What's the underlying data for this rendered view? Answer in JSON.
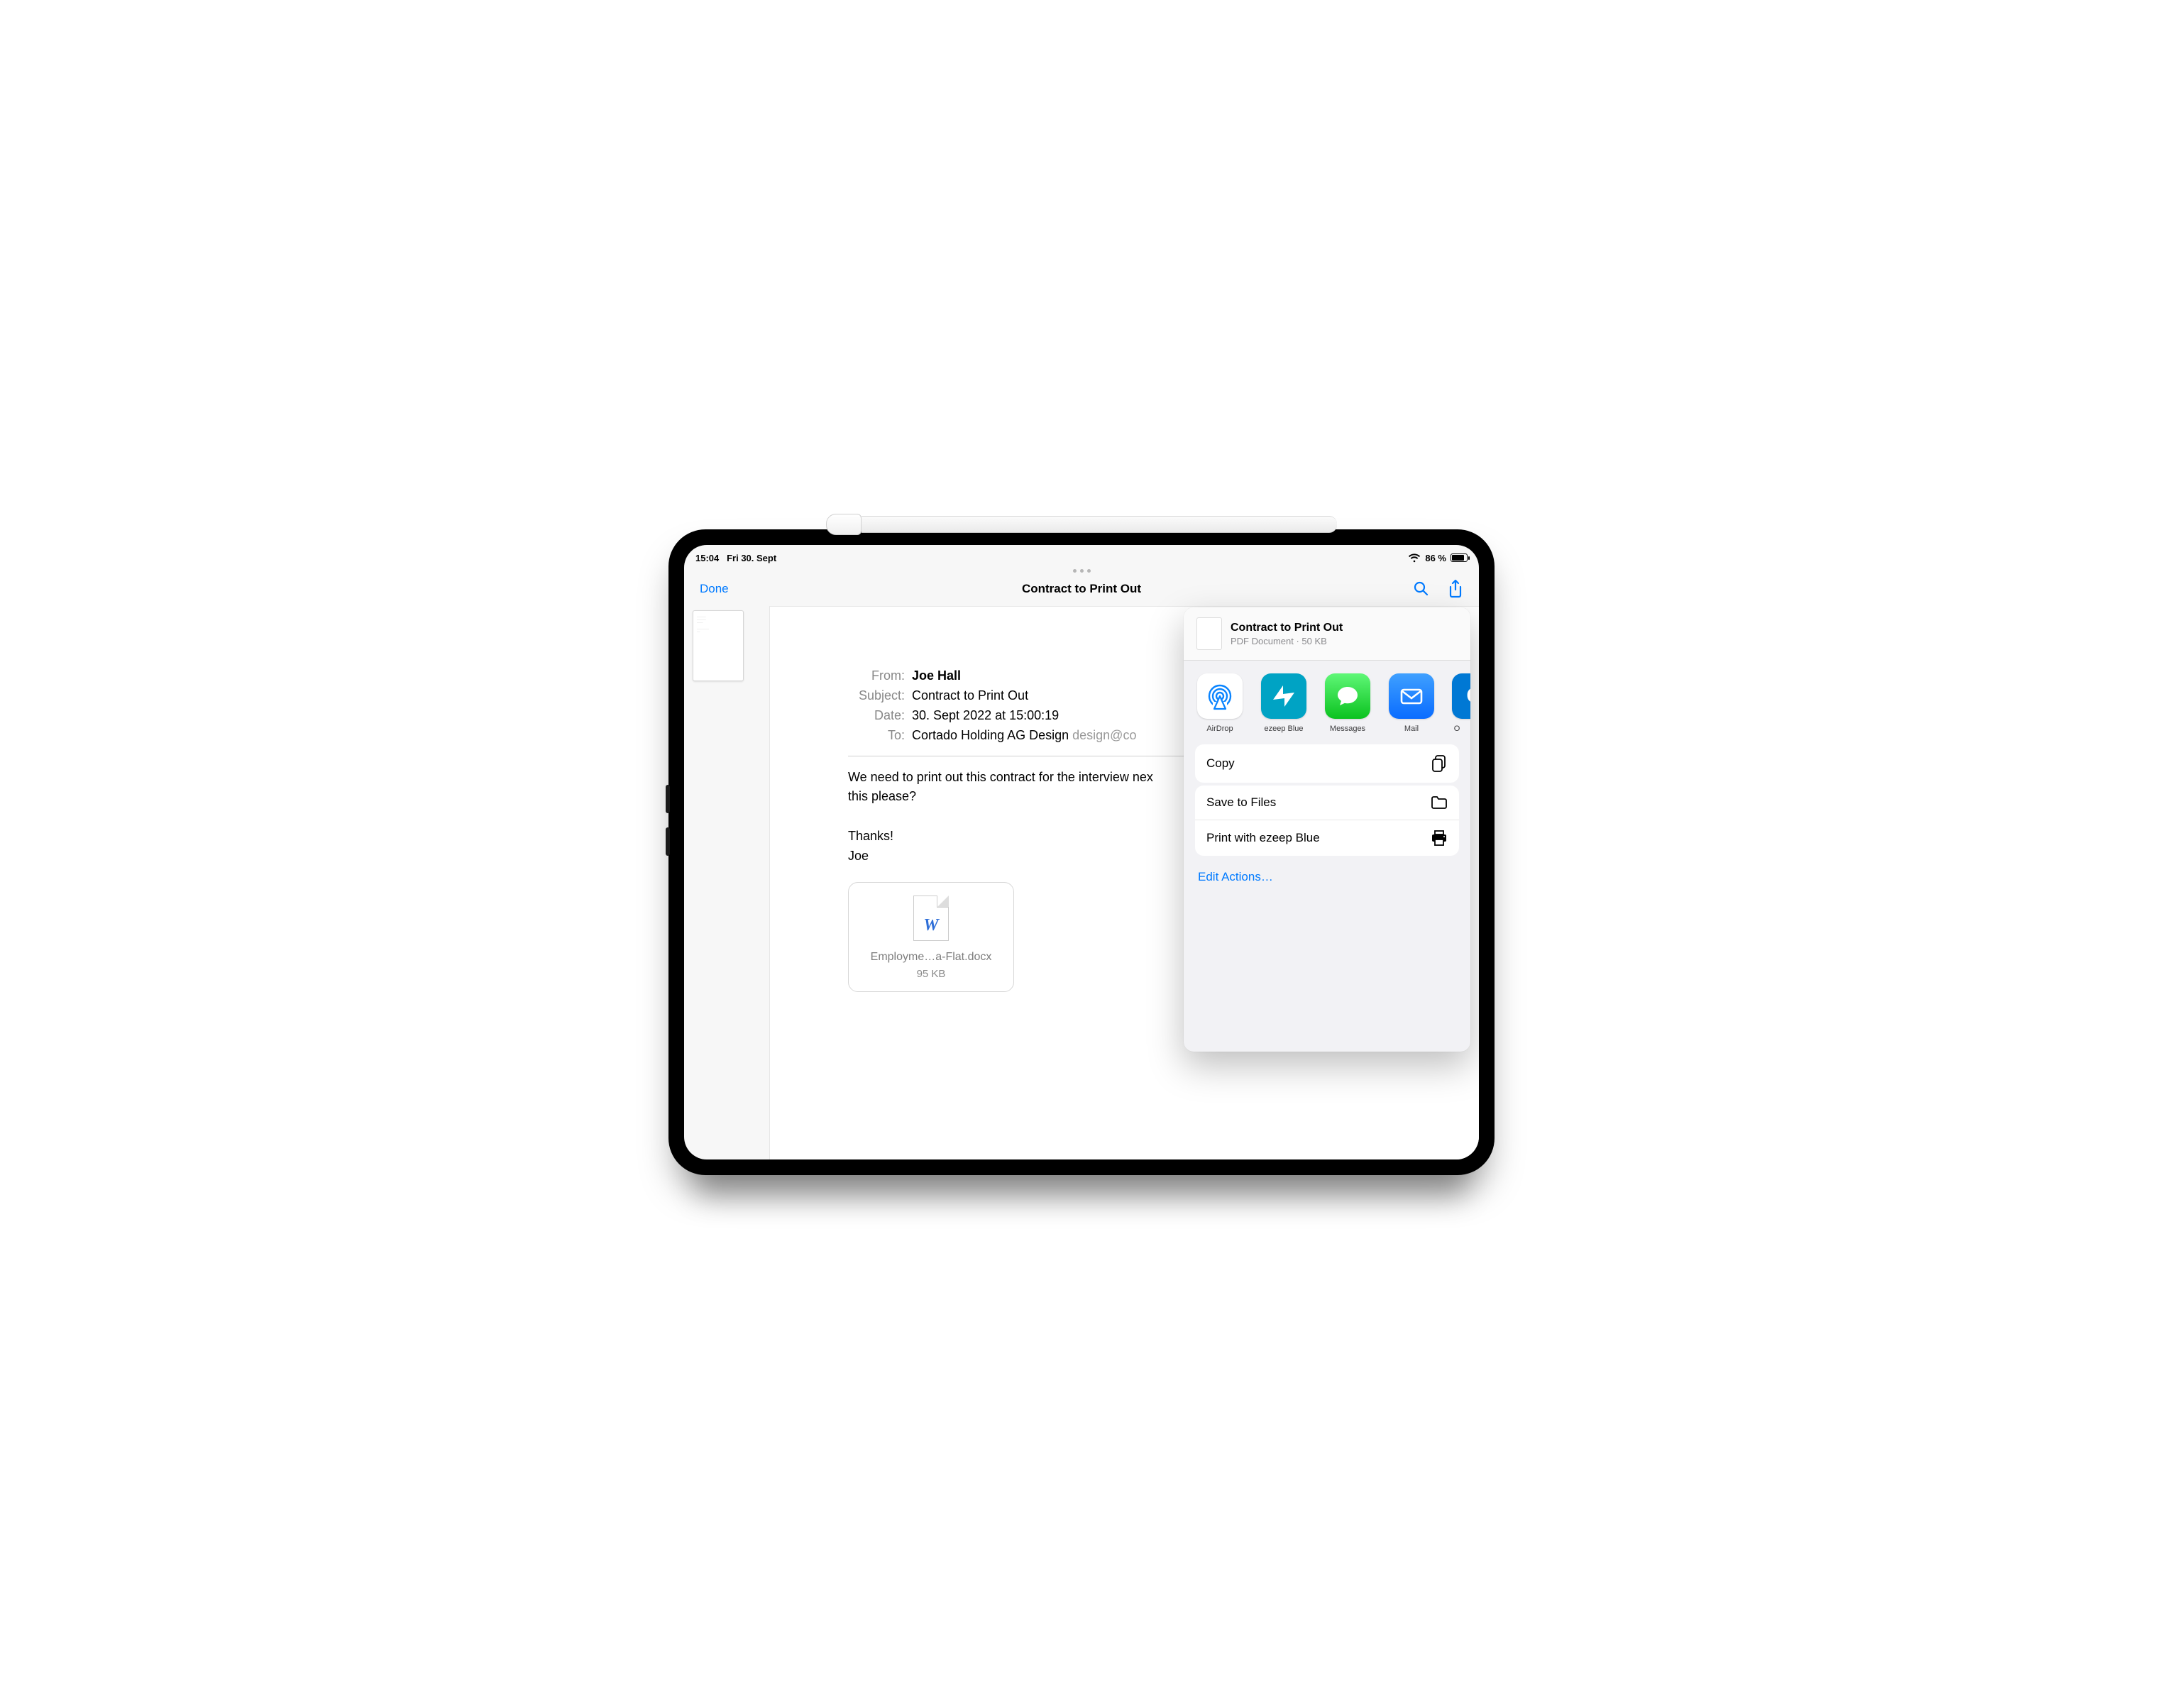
{
  "status": {
    "time": "15:04",
    "date": "Fri 30. Sept",
    "battery_percent": "86 %"
  },
  "nav": {
    "done": "Done",
    "title": "Contract to Print Out"
  },
  "email": {
    "labels": {
      "from": "From:",
      "subject": "Subject:",
      "date": "Date:",
      "to": "To:"
    },
    "from": "Joe Hall",
    "subject": "Contract to Print Out",
    "date": "30. Sept 2022 at 15:00:19",
    "to_name": "Cortado Holding AG Design",
    "to_email": "design@co",
    "body_line1": "We need to print out this contract for the interview nex",
    "body_line2": "this please?",
    "thanks": "Thanks!",
    "signoff": "Joe",
    "attachment": {
      "glyph": "W",
      "name": "Employme…a-Flat.docx",
      "size": "95 KB"
    }
  },
  "share": {
    "title": "Contract to Print Out",
    "subtitle": "PDF Document · 50 KB",
    "apps": {
      "airdrop": "AirDrop",
      "ezeep": "ezeep Blue",
      "messages": "Messages",
      "mail": "Mail",
      "outlook": "O"
    },
    "actions": {
      "copy": "Copy",
      "save": "Save to Files",
      "print": "Print with ezeep Blue",
      "edit": "Edit Actions…"
    }
  }
}
